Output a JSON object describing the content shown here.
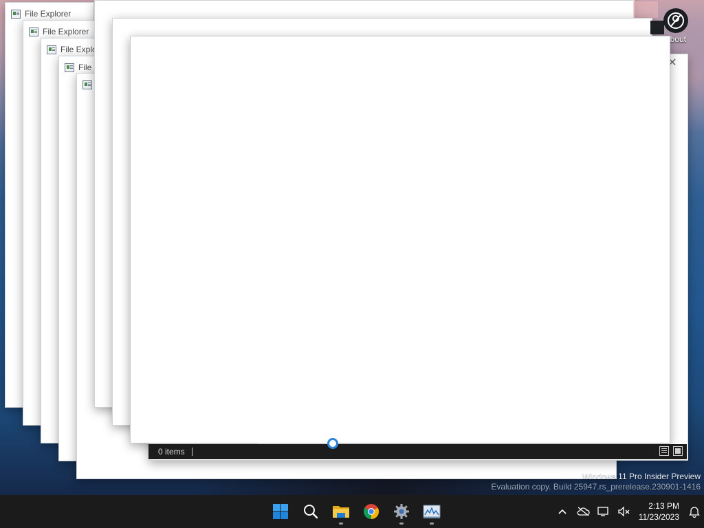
{
  "desktop": {
    "icon_label": "about"
  },
  "windows": [
    {
      "title": "File Explorer"
    },
    {
      "title": "File Explorer"
    },
    {
      "title": "File Explorer"
    },
    {
      "title": "File"
    },
    {
      "title": ""
    }
  ],
  "status_bar": {
    "item_count": "0 items",
    "view_details_icon": "details-view-icon",
    "view_tiles_icon": "large-icons-view-icon"
  },
  "watermark": {
    "line1": "Windows 11 Pro Insider Preview",
    "line2": "Evaluation copy. Build 25947.rs_prerelease.230901-1416"
  },
  "taskbar": {
    "apps": [
      {
        "name": "start",
        "icon": "windows-logo-icon"
      },
      {
        "name": "search",
        "icon": "search-icon"
      },
      {
        "name": "file-explorer",
        "icon": "folder-icon"
      },
      {
        "name": "chrome",
        "icon": "chrome-icon"
      },
      {
        "name": "settings",
        "icon": "gear-icon"
      },
      {
        "name": "performance-monitor",
        "icon": "monitor-chart-icon"
      }
    ],
    "clock": {
      "time": "2:13 PM",
      "date": "11/23/2023"
    }
  }
}
